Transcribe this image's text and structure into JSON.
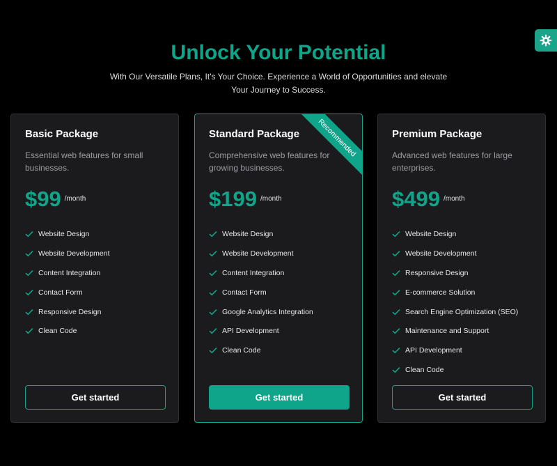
{
  "page": {
    "title": "Unlock Your Potential",
    "subtitle": "With Our Versatile Plans, It's Your Choice. Experience a World of Opportunities and elevate Your Journey to Success."
  },
  "theme_toggle": {
    "icon": "gear-icon",
    "color": "#1aa58a"
  },
  "colors": {
    "accent": "#0fa58a",
    "background": "#000000",
    "card": "#1b1b1d"
  },
  "plans": [
    {
      "name": "Basic Package",
      "description": "Essential web features for small businesses.",
      "price": "$99",
      "period": "/month",
      "features": [
        "Website Design",
        "Website Development",
        "Content Integration",
        "Contact Form",
        "Responsive Design",
        "Clean Code"
      ],
      "cta": "Get started"
    },
    {
      "name": "Standard Package",
      "description": "Comprehensive web features for growing businesses.",
      "price": "$199",
      "period": "/month",
      "badge": "Recommended",
      "features": [
        "Website Design",
        "Website Development",
        "Content Integration",
        "Contact Form",
        "Google Analytics Integration",
        "API Development",
        "Clean Code"
      ],
      "cta": "Get started"
    },
    {
      "name": "Premium Package",
      "description": "Advanced web features for large enterprises.",
      "price": "$499",
      "period": "/month",
      "features": [
        "Website Design",
        "Website Development",
        "Responsive Design",
        "E-commerce Solution",
        "Search Engine Optimization (SEO)",
        "Maintenance and Support",
        "API Development",
        "Clean Code"
      ],
      "cta": "Get started"
    }
  ]
}
